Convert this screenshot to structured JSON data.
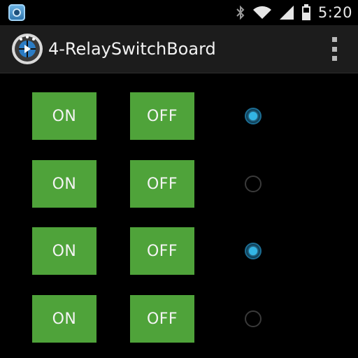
{
  "status_bar": {
    "notification_icon": "app-notification-icon",
    "icons": [
      "bluetooth-icon",
      "wifi-icon",
      "signal-icon",
      "battery-icon"
    ],
    "time": "5:20"
  },
  "action_bar": {
    "logo_icon": "app-logo-icon",
    "title": "4-RelaySwitchBoard",
    "overflow_icon": "overflow-menu-icon"
  },
  "relays": [
    {
      "on_label": "ON",
      "off_label": "OFF",
      "indicator_checked": true
    },
    {
      "on_label": "ON",
      "off_label": "OFF",
      "indicator_checked": false
    },
    {
      "on_label": "ON",
      "off_label": "OFF",
      "indicator_checked": true
    },
    {
      "on_label": "ON",
      "off_label": "OFF",
      "indicator_checked": false
    }
  ],
  "colors": {
    "button_green": "#4fa33a",
    "radio_accent": "#33b5e5",
    "action_bar_bg": "#1c1c1c",
    "background": "#000000"
  }
}
